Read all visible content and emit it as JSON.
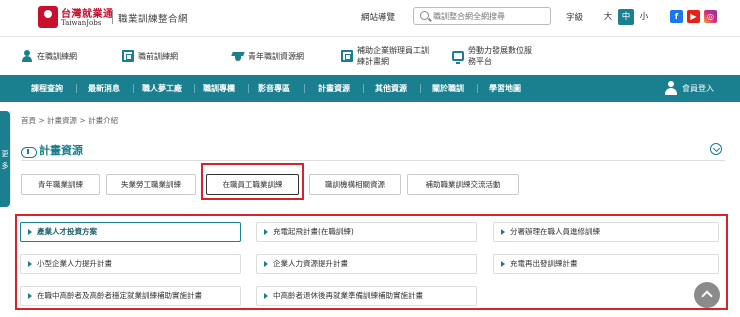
{
  "header": {
    "logo_cn": "台灣就業通",
    "logo_en": "TaiwanJobs",
    "site_name": "職業訓練整合網",
    "nav_guide": "網站導覽",
    "search_placeholder": "職訓整合網全網搜尋",
    "font_size_label": "字級",
    "font_sizes": [
      "大",
      "中",
      "小"
    ],
    "social": {
      "facebook": "f",
      "youtube": "▶",
      "instagram": "◎"
    }
  },
  "shortcuts": [
    {
      "label": "在職訓練網",
      "icon": "person-icon"
    },
    {
      "label": "職前訓練網",
      "icon": "building-icon"
    },
    {
      "label": "青年職訓資源網",
      "icon": "graduation-cap-icon"
    },
    {
      "label_line1": "補助企業辦理員工訓",
      "label_line2": "練計畫網",
      "icon": "building-icon"
    },
    {
      "label_line1": "勞動力發展數位服",
      "label_line2": "務平台",
      "icon": "monitor-icon"
    }
  ],
  "main_nav": [
    "課程查詢",
    "最新消息",
    "職人夢工廠",
    "職訓專欄",
    "影音專區",
    "計畫資源",
    "其他資源",
    "關於職訓",
    "學習地圖"
  ],
  "member_login": "會員登入",
  "side_tab": {
    "line1": "更",
    "line2": "多"
  },
  "breadcrumb": "首頁 > 計畫資源 > 計畫介紹",
  "page_title": "計畫資源",
  "tabs": [
    "青年職業訓練",
    "失業勞工職業訓練",
    "在職員工職業訓練",
    "職訓機構相關資源",
    "補助職業訓練交流活動"
  ],
  "active_tab": "在職員工職業訓練",
  "programs": [
    "產業人才投資方案",
    "充電起飛計畫(在職訓練)",
    "分署辦理在職人員進修訓練",
    "小型企業人力提升計畫",
    "企業人力資源提升計畫",
    "充電再出發訓練計畫",
    "在職中高齡者及高齡者穩定就業訓練補助實施計畫",
    "中高齡者退休後再就業準備訓練補助實施計畫"
  ],
  "active_program": "產業人才投資方案",
  "colors": {
    "primary": "#1a7f8e",
    "brand_red": "#c8102e",
    "highlight_red": "#d9232a"
  }
}
